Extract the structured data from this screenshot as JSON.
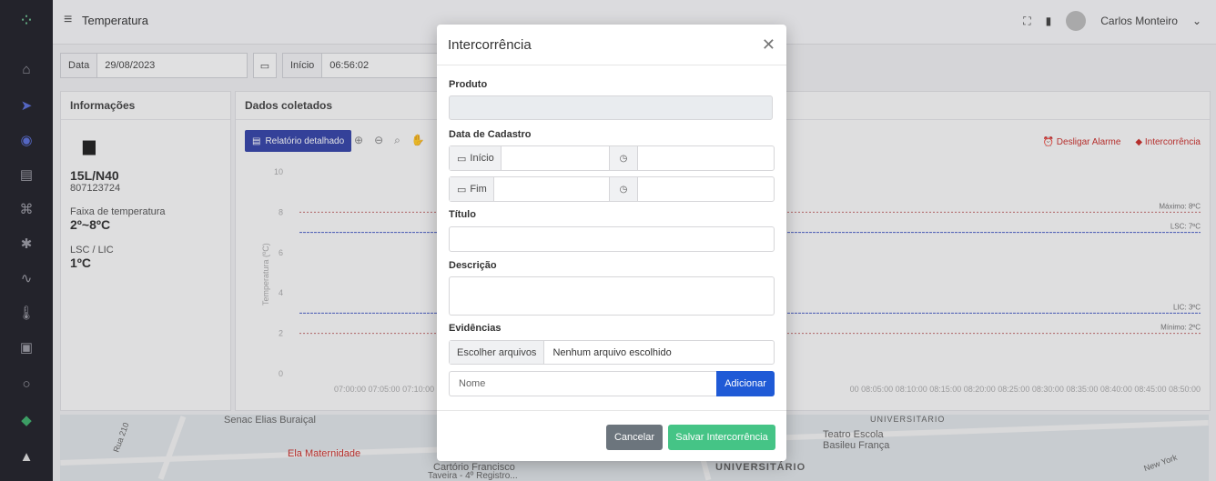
{
  "header": {
    "title": "Temperatura",
    "user_name": "Carlos Monteiro"
  },
  "filters": {
    "date_label": "Data",
    "date_value": "29/08/2023",
    "start_label": "Início",
    "start_time": "06:56:02"
  },
  "info_card": {
    "title": "Informações",
    "device_name": "15L/N40",
    "device_serial": "807123724",
    "range_label": "Faixa de temperatura",
    "range_value": "2º~8ºC",
    "lsc_lic_label": "LSC / LIC",
    "lsc_lic_value": "1ºC"
  },
  "data_card": {
    "title": "Dados coletados",
    "report_button": "Relatório detalhado",
    "alarm_off": "Desligar Alarme",
    "incident_link": "Intercorrência",
    "y_axis_label": "Temperatura (ºC)"
  },
  "chart_data": {
    "type": "line",
    "yticks": [
      "10",
      "8",
      "6",
      "4",
      "2",
      "0"
    ],
    "ylim": [
      0,
      10
    ],
    "x_ticks_left": "07:00:00 07:05:00 07:10:00 07:1",
    "x_ticks_right": "00 08:05:00 08:10:00 08:15:00 08:20:00 08:25:00 08:30:00 08:35:00 08:40:00 08:45:00 08:50:00",
    "thresholds": [
      {
        "label": "Máximo: 8ºC",
        "value": 8
      },
      {
        "label": "LSC: 7ºC",
        "value": 7
      },
      {
        "label": "LIC: 3ºC",
        "value": 3
      },
      {
        "label": "Mínimo: 2ºC",
        "value": 2
      }
    ]
  },
  "map": {
    "labels": [
      "Senac Elias Buraiçal",
      "Ela Maternidade",
      "Cartório Francisco",
      "Taveira - 4º Registro...",
      "Teatro Escola",
      "Basileu França",
      "UNIVERSITÁRIO",
      "UNIVERSITARIO",
      "Rua 210",
      "New York"
    ]
  },
  "modal": {
    "title": "Intercorrência",
    "produto_label": "Produto",
    "cadastro_label": "Data de Cadastro",
    "inicio_label": "Início",
    "fim_label": "Fim",
    "titulo_label": "Título",
    "descricao_label": "Descrição",
    "evidencias_label": "Evidências",
    "choose_files": "Escolher arquivos",
    "no_file": "Nenhum arquivo escolhido",
    "nome_placeholder": "Nome",
    "add_button": "Adicionar",
    "cancel_button": "Cancelar",
    "save_button": "Salvar Intercorrência"
  }
}
